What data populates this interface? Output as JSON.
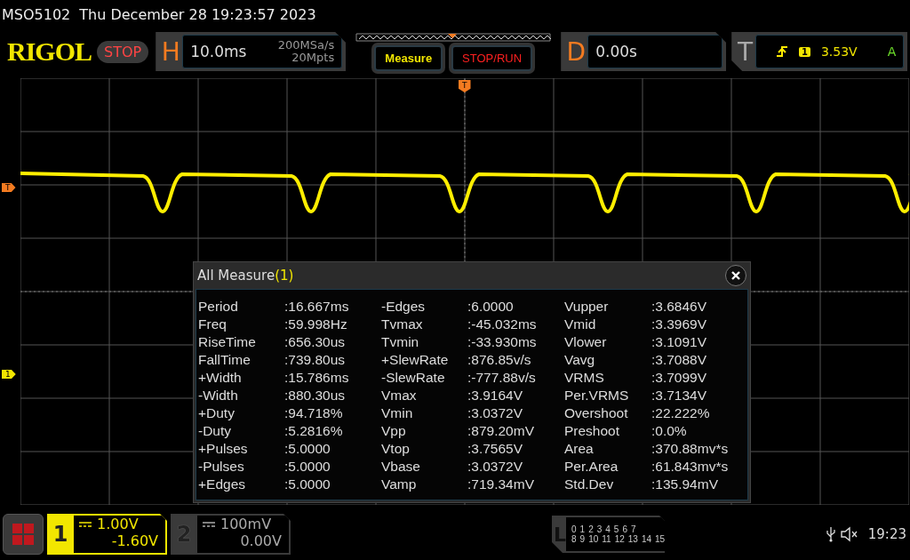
{
  "header": {
    "model": "MSO5102",
    "datetime": "Thu December 28 19:23:57 2023"
  },
  "toolbar": {
    "logo": "RIGOL",
    "run_state": "STOP",
    "horizontal": {
      "label": "H",
      "timebase": "10.0ms",
      "sample_rate": "200MSa/s",
      "memory_depth": "20Mpts"
    },
    "buttons": [
      {
        "label": "Measure",
        "kind": "measure"
      },
      {
        "label": "STOP/RUN",
        "kind": "stoprun"
      }
    ],
    "delay": {
      "label": "D",
      "value": "0.00s"
    },
    "trigger": {
      "label": "T",
      "source": "1",
      "level": "3.53V",
      "mode": "A"
    }
  },
  "screen": {
    "trigger_position_marker": "T",
    "trigger_level_marker": "T",
    "channel_marker": "1"
  },
  "dialog": {
    "title": "All Measure",
    "count": "(1)",
    "columns": [
      [
        {
          "name": "Period",
          "value": ":16.667ms"
        },
        {
          "name": "Freq",
          "value": ":59.998Hz"
        },
        {
          "name": "RiseTime",
          "value": ":656.30us"
        },
        {
          "name": "FallTime",
          "value": ":739.80us"
        },
        {
          "name": "+Width",
          "value": ":15.786ms"
        },
        {
          "name": "-Width",
          "value": ":880.30us"
        },
        {
          "name": "+Duty",
          "value": ":94.718%"
        },
        {
          "name": "-Duty",
          "value": ":5.2816%"
        },
        {
          "name": "+Pulses",
          "value": ":5.0000"
        },
        {
          "name": "-Pulses",
          "value": ":5.0000"
        },
        {
          "name": "+Edges",
          "value": ":5.0000"
        }
      ],
      [
        {
          "name": "-Edges",
          "value": ":6.0000"
        },
        {
          "name": "Tvmax",
          "value": ":-45.032ms"
        },
        {
          "name": "Tvmin",
          "value": ":-33.930ms"
        },
        {
          "name": "+SlewRate",
          "value": ":876.85v/s"
        },
        {
          "name": "-SlewRate",
          "value": ":-777.88v/s"
        },
        {
          "name": "Vmax",
          "value": ":3.9164V"
        },
        {
          "name": "Vmin",
          "value": ":3.0372V"
        },
        {
          "name": "Vpp",
          "value": ":879.20mV"
        },
        {
          "name": "Vtop",
          "value": ":3.7565V"
        },
        {
          "name": "Vbase",
          "value": ":3.0372V"
        },
        {
          "name": "Vamp",
          "value": ":719.34mV"
        }
      ],
      [
        {
          "name": "Vupper",
          "value": ":3.6846V"
        },
        {
          "name": "Vmid",
          "value": ":3.3969V"
        },
        {
          "name": "Vlower",
          "value": ":3.1091V"
        },
        {
          "name": "Vavg",
          "value": ":3.7088V"
        },
        {
          "name": "VRMS",
          "value": ":3.7099V"
        },
        {
          "name": "Per.VRMS",
          "value": ":3.7134V"
        },
        {
          "name": "Overshoot",
          "value": ":22.222%"
        },
        {
          "name": "Preshoot",
          "value": ":0.0%"
        },
        {
          "name": "Area",
          "value": ":370.88mv*s"
        },
        {
          "name": "Per.Area",
          "value": ":61.843mv*s"
        },
        {
          "name": "Std.Dev",
          "value": ":135.94mV"
        }
      ]
    ]
  },
  "channels": [
    {
      "number": "1",
      "scale": "1.00V",
      "offset": "-1.60V",
      "selected": true
    },
    {
      "number": "2",
      "scale": "100mV",
      "offset": "0.00V",
      "selected": false
    }
  ],
  "logic": {
    "label": "L",
    "row1": [
      "0",
      "1",
      "2",
      "3",
      "4",
      "5",
      "6",
      "7"
    ],
    "row2": [
      "8",
      "9",
      "10",
      "11",
      "12",
      "13",
      "14",
      "15"
    ]
  },
  "status": {
    "time": "19:23"
  }
}
